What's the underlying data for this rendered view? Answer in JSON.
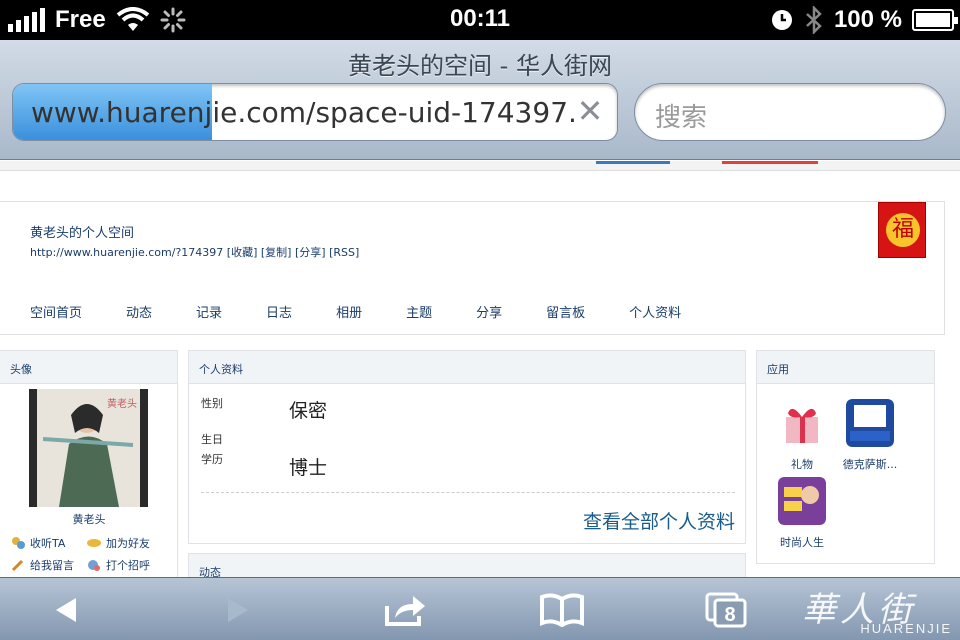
{
  "status_bar": {
    "carrier": "Free",
    "time": "00:11",
    "battery": "100 %"
  },
  "browser": {
    "page_title": "黄老头的空间 - 华人街网",
    "url": "www.huarenjie.com/space-uid-174397.h",
    "load_progress": 0.33,
    "search_placeholder": "搜索"
  },
  "space": {
    "title": "黄老头的个人空间",
    "url": "http://www.huarenjie.com/?174397",
    "links": [
      "[收藏]",
      "[复制]",
      "[分享]",
      "[RSS]"
    ],
    "badge": "福",
    "nav": [
      "空间首页",
      "动态",
      "记录",
      "日志",
      "相册",
      "主题",
      "分享",
      "留言板",
      "个人资料"
    ]
  },
  "avatar_panel": {
    "heading": "头像",
    "name": "黄老头",
    "actions": [
      "收听TA",
      "加为好友",
      "给我留言",
      "打个招呼"
    ]
  },
  "profile_panel": {
    "heading": "个人资料",
    "fields": [
      {
        "label": "性别",
        "value": "保密"
      },
      {
        "label": "生日",
        "value": ""
      },
      {
        "label": "学历",
        "value": "博士"
      }
    ],
    "view_all": "查看全部个人资料"
  },
  "activity_panel": {
    "heading": "动态"
  },
  "apps_panel": {
    "heading": "应用",
    "apps": [
      "礼物",
      "德克萨斯...",
      "时尚人生"
    ]
  },
  "toolbar": {
    "tabs_count": "8",
    "watermark_cn": "華人街",
    "watermark_en": "HUARENJIE"
  },
  "colors": {
    "link_blue": "#1a3d6b",
    "progress_blue": "#3a90dc",
    "badge_red": "#d71414"
  }
}
